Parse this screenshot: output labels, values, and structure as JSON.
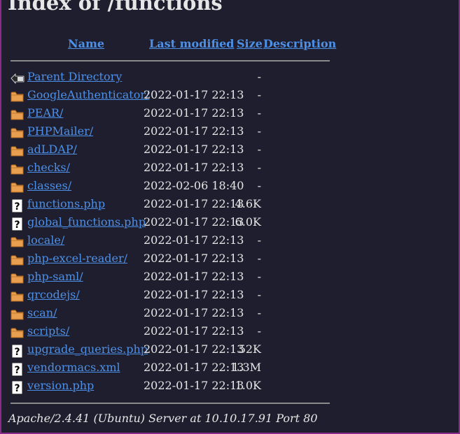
{
  "page": {
    "title": "Index of /functions",
    "footer": "Apache/2.4.41 (Ubuntu) Server at 10.10.17.91 Port 80"
  },
  "table": {
    "headers": {
      "name": "Name",
      "last_modified": "Last modified",
      "size": "Size",
      "description": "Description"
    },
    "rows": [
      {
        "icon": "back-icon",
        "name": "Parent Directory",
        "modified": "",
        "size": "-"
      },
      {
        "icon": "folder-icon",
        "name": "GoogleAuthenticator/",
        "modified": "2022-01-17 22:13",
        "size": "-"
      },
      {
        "icon": "folder-icon",
        "name": "PEAR/",
        "modified": "2022-01-17 22:13",
        "size": "-"
      },
      {
        "icon": "folder-icon",
        "name": "PHPMailer/",
        "modified": "2022-01-17 22:13",
        "size": "-"
      },
      {
        "icon": "folder-icon",
        "name": "adLDAP/",
        "modified": "2022-01-17 22:13",
        "size": "-"
      },
      {
        "icon": "folder-icon",
        "name": "checks/",
        "modified": "2022-01-17 22:13",
        "size": "-"
      },
      {
        "icon": "folder-icon",
        "name": "classes/",
        "modified": "2022-02-06 18:40",
        "size": "-"
      },
      {
        "icon": "unknown-file-icon",
        "name": "functions.php",
        "modified": "2022-01-17 22:13",
        "size": "4.6K"
      },
      {
        "icon": "unknown-file-icon",
        "name": "global_functions.php",
        "modified": "2022-01-17 22:13",
        "size": "6.0K"
      },
      {
        "icon": "folder-icon",
        "name": "locale/",
        "modified": "2022-01-17 22:13",
        "size": "-"
      },
      {
        "icon": "folder-icon",
        "name": "php-excel-reader/",
        "modified": "2022-01-17 22:13",
        "size": "-"
      },
      {
        "icon": "folder-icon",
        "name": "php-saml/",
        "modified": "2022-01-17 22:13",
        "size": "-"
      },
      {
        "icon": "folder-icon",
        "name": "qrcodejs/",
        "modified": "2022-01-17 22:13",
        "size": "-"
      },
      {
        "icon": "folder-icon",
        "name": "scan/",
        "modified": "2022-01-17 22:13",
        "size": "-"
      },
      {
        "icon": "folder-icon",
        "name": "scripts/",
        "modified": "2022-01-17 22:13",
        "size": "-"
      },
      {
        "icon": "unknown-file-icon",
        "name": "upgrade_queries.php",
        "modified": "2022-01-17 22:13",
        "size": "52K"
      },
      {
        "icon": "unknown-file-icon",
        "name": "vendormacs.xml",
        "modified": "2022-01-17 22:13",
        "size": "1.3M"
      },
      {
        "icon": "unknown-file-icon",
        "name": "version.php",
        "modified": "2022-01-17 22:13",
        "size": "1.0K"
      }
    ]
  },
  "colors": {
    "background": "#1e1e2e",
    "text": "#e6e6e6",
    "link": "#4d90e8",
    "folder": "#e8a050",
    "rule": "#8a8a8a"
  }
}
